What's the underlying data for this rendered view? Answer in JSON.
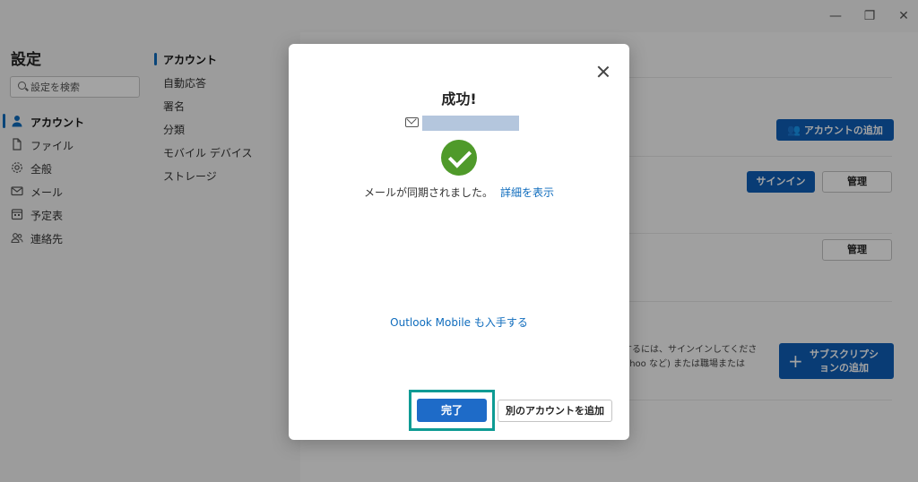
{
  "window": {
    "minimize_glyph": "—",
    "restore_glyph": "❐",
    "close_glyph": "✕"
  },
  "sidebar": {
    "title": "設定",
    "search_placeholder": "設定を検索",
    "items": [
      {
        "label": "アカウント",
        "icon": "person-icon",
        "active": true
      },
      {
        "label": "ファイル",
        "icon": "document-icon"
      },
      {
        "label": "全般",
        "icon": "gear-icon"
      },
      {
        "label": "メール",
        "icon": "mail-icon"
      },
      {
        "label": "予定表",
        "icon": "calendar-icon"
      },
      {
        "label": "連絡先",
        "icon": "people-icon"
      }
    ]
  },
  "subnav": {
    "items": [
      {
        "label": "アカウント",
        "active": true
      },
      {
        "label": "自動応答"
      },
      {
        "label": "署名"
      },
      {
        "label": "分類"
      },
      {
        "label": "モバイル デバイス"
      },
      {
        "label": "ストレージ"
      }
    ]
  },
  "panel": {
    "add_account_label": "アカウントの追加",
    "signin_label": "サインイン",
    "manage_label_1": "管理",
    "manage_label_2": "管理",
    "partial_text_1": "化するには、サインインしてくださ",
    "partial_text_2": ", Yahoo など) または職場または",
    "subscription_label_1": "サブスクリプシ",
    "subscription_label_2": "ョンの追加"
  },
  "dialog": {
    "title": "成功!",
    "sync_message": "メールが同期されました。",
    "details_link": "詳細を表示",
    "mobile_link": "Outlook Mobile も入手する",
    "done_label": "完了",
    "add_another_label": "別のアカウントを追加"
  },
  "colors": {
    "accent": "#0f6cbd",
    "primary_button": "#1e6bc8",
    "success": "#4f9a2a",
    "highlight": "#0e9b94"
  }
}
